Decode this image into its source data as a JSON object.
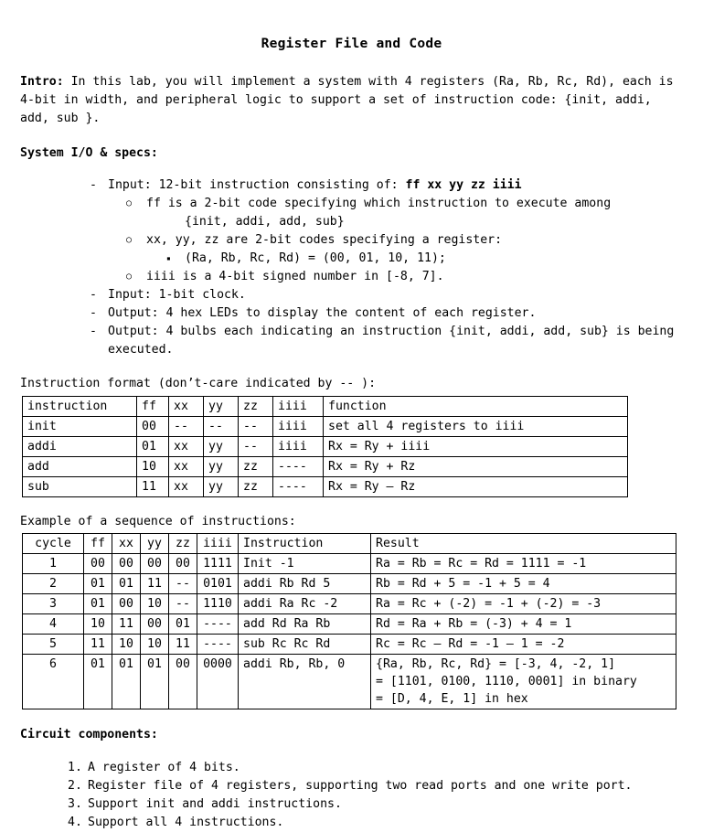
{
  "document": {
    "title": "Register File and Code",
    "intro": {
      "label": "Intro:",
      "text": " In this lab, you will implement a system with 4 registers (Ra, Rb, Rc, Rd), each is 4-bit in width, and peripheral logic to support a set of instruction code: {init, addi, add, sub }."
    },
    "specs_heading": "System I/O & specs:",
    "specs": {
      "input_instruction_prefix": "Input: 12-bit instruction consisting of: ",
      "input_instruction_bold": "ff xx yy zz iiii",
      "ff_line": "ff is a 2-bit code specifying which instruction to execute among",
      "ff_line_cont": "{init, addi, add, sub}",
      "xyz_line": "xx, yy, zz are 2-bit codes specifying a register:",
      "register_encoding": "(Ra, Rb, Rc, Rd) = (00, 01, 10, 11);",
      "iiii_line": "iiii is a 4-bit signed number in [-8, 7].",
      "input_clock": "Input: 1-bit clock.",
      "output_leds": "Output: 4 hex LEDs to display the content of each register.",
      "output_bulbs": "Output: 4 bulbs each indicating an instruction {init, addi, add, sub} is being",
      "output_bulbs_cont": "executed."
    },
    "instruction_format": {
      "caption": "Instruction format (don’t-care indicated by -- ):",
      "headers": [
        "instruction",
        "ff",
        "xx",
        "yy",
        "zz",
        "iiii",
        "function"
      ],
      "rows": [
        [
          "init",
          "00",
          "--",
          "--",
          "--",
          "iiii",
          "set all 4 registers to iiii"
        ],
        [
          "addi",
          "01",
          "xx",
          "yy",
          "--",
          "iiii",
          "Rx = Ry + iiii"
        ],
        [
          "add",
          "10",
          "xx",
          "yy",
          "zz",
          "----",
          "Rx = Ry + Rz"
        ],
        [
          "sub",
          "11",
          "xx",
          "yy",
          "zz",
          "----",
          "Rx = Ry – Rz"
        ]
      ]
    },
    "example": {
      "caption": "Example of a sequence of instructions:",
      "headers": [
        "cycle",
        "ff",
        "xx",
        "yy",
        "zz",
        "iiii",
        "Instruction",
        "Result"
      ],
      "rows": [
        [
          "1",
          "00",
          "00",
          "00",
          "00",
          "1111",
          "Init -1",
          "Ra = Rb = Rc = Rd = 1111 = -1"
        ],
        [
          "2",
          "01",
          "01",
          "11",
          "--",
          "0101",
          "addi Rb Rd 5",
          "Rb = Rd + 5 = -1 + 5 = 4"
        ],
        [
          "3",
          "01",
          "00",
          "10",
          "--",
          "1110",
          "addi Ra Rc -2",
          "Ra = Rc + (-2) = -1 + (-2) = -3"
        ],
        [
          "4",
          "10",
          "11",
          "00",
          "01",
          "----",
          "add Rd Ra Rb",
          "Rd = Ra + Rb = (-3) + 4 = 1"
        ],
        [
          "5",
          "11",
          "10",
          "10",
          "11",
          "----",
          "sub Rc Rc Rd",
          "Rc = Rc – Rd = -1 – 1 = -2"
        ],
        [
          "6",
          "01",
          "01",
          "01",
          "00",
          "0000",
          "addi Rb, Rb, 0",
          "{Ra, Rb, Rc, Rd} = [-3, 4, -2, 1]\n= [1101, 0100, 1110, 0001] in binary\n= [D, 4, E, 1] in hex"
        ]
      ]
    },
    "components_heading": "Circuit components:",
    "components": [
      "A register of 4 bits.",
      "Register file of 4 registers, supporting two read ports and one write port.",
      "Support init and addi instructions.",
      "Support all 4 instructions."
    ]
  }
}
